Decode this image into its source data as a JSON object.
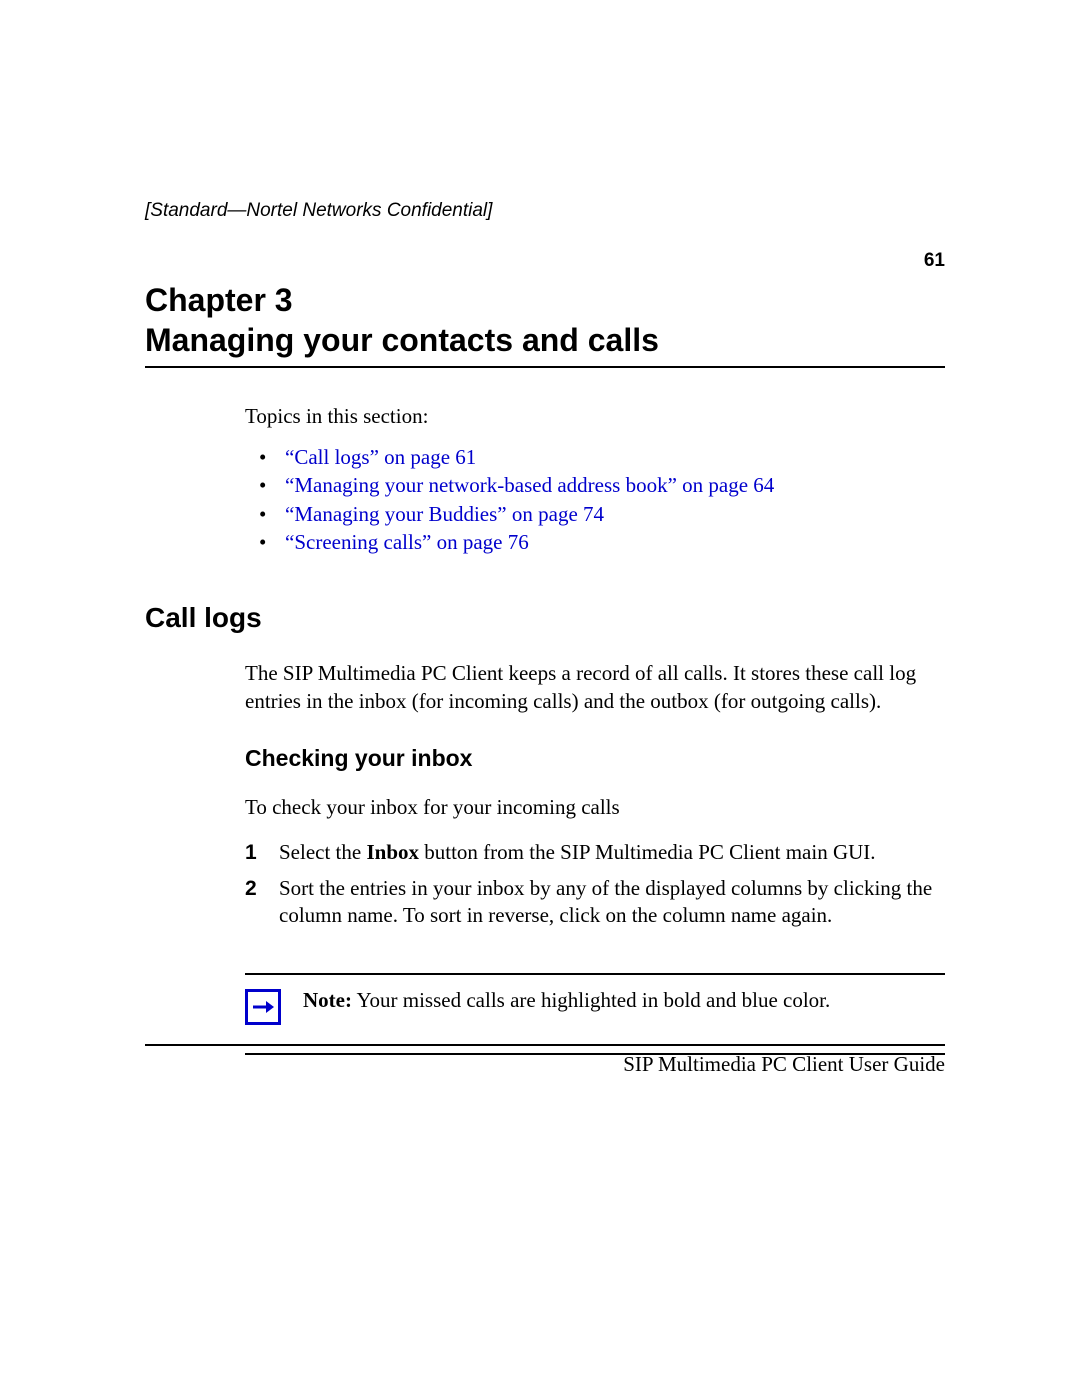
{
  "header": {
    "confidential": "[Standard—Nortel Networks Confidential]",
    "page_number": "61"
  },
  "chapter": {
    "label": "Chapter 3",
    "title": "Managing your contacts and calls"
  },
  "topics_intro": "Topics in this section:",
  "topics": [
    "“Call logs” on page 61",
    "“Managing your network-based address book” on page 64",
    "“Managing your Buddies” on page 74",
    "“Screening calls” on page 76"
  ],
  "section": {
    "heading": "Call logs",
    "para": "The SIP Multimedia PC Client keeps a record of all calls. It stores these call log entries in the inbox (for incoming calls) and the outbox (for outgoing calls)."
  },
  "subsection": {
    "heading": "Checking your inbox",
    "intro": "To check your inbox for your incoming calls",
    "steps": [
      {
        "num": "1",
        "pre": "Select the ",
        "bold": "Inbox",
        "post": " button from the SIP Multimedia PC Client main GUI."
      },
      {
        "num": "2",
        "pre": "Sort the entries in your inbox by any of the displayed columns by clicking the column name. To sort in reverse, click on the column name again.",
        "bold": "",
        "post": ""
      }
    ]
  },
  "note": {
    "lead": "Note:",
    "text": " Your missed calls are highlighted in bold and blue color."
  },
  "footer": "SIP Multimedia PC Client User Guide"
}
